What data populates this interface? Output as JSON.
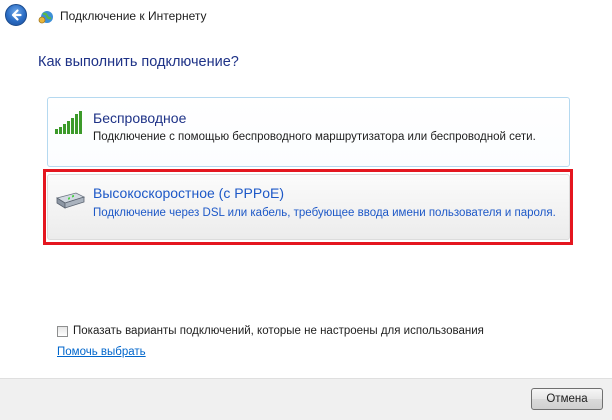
{
  "window": {
    "title": "Подключение к Интернету",
    "back_icon": "back-arrow-icon",
    "app_icon": "network-globe-icon"
  },
  "heading": "Как выполнить подключение?",
  "options": [
    {
      "title": "Беспроводное",
      "description": "Подключение с помощью беспроводного маршрутизатора или беспроводной сети.",
      "icon": "wireless-signal-icon"
    },
    {
      "title": "Высокоскоростное (с PPPoE)",
      "description": "Подключение через DSL или кабель, требующее ввода имени пользователя и пароля.",
      "icon": "broadband-modem-icon",
      "highlighted": true
    }
  ],
  "show_unconfigured": {
    "label": "Показать варианты подключений, которые не настроены для использования",
    "checked": false
  },
  "help_link": "Помочь выбрать",
  "cancel_button": "Отмена",
  "colors": {
    "heading": "#1e3287",
    "link": "#0066cc",
    "highlight": "#e4161f"
  }
}
